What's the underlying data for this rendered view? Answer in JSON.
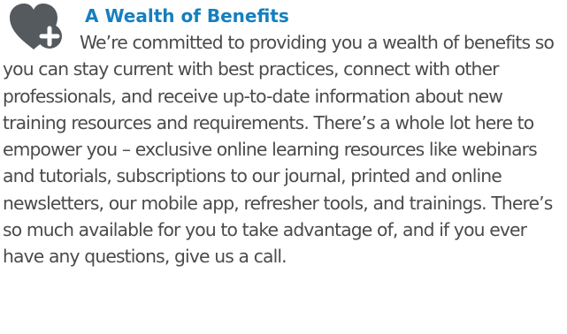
{
  "icon": {
    "name": "heart-plus-icon",
    "heart_color": "#555a5f",
    "plus_color": "#ffffff"
  },
  "title": "A Wealth of Benefits",
  "body": "We’re committed to providing you a wealth of benefits so you can stay current with best practices, connect with other professionals, and receive up-to-date information about new training resources and requirements. There’s a whole lot here to empower you – exclusive online learning resources like webinars and tutorials, subscriptions to our journal, printed and online newsletters, our mobile app, refresher tools, and trainings. There’s so much available for you to take advantage of, and if you ever have any questions, give us a call.",
  "colors": {
    "title": "#157fc0",
    "text": "#4b4b4b"
  }
}
